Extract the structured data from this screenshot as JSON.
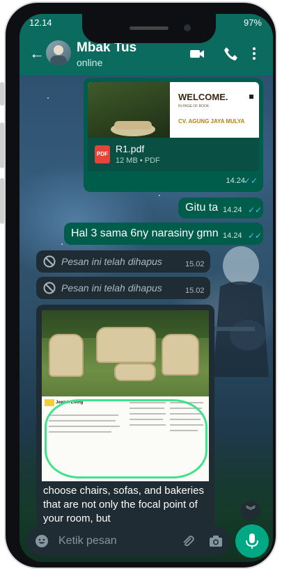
{
  "status": {
    "time": "12.14",
    "battery": "97%"
  },
  "header": {
    "name": "Mbak Tus",
    "presence": "online"
  },
  "messages": {
    "pdf": {
      "welcome": "WELCOME.",
      "sub": "IN PAGE OF BOOK",
      "company": "CV. AGUNG JAYA MULYA",
      "filename": "R1.pdf",
      "fileinfo": "12 MB • PDF",
      "time": "14.24",
      "ticks": "✓✓"
    },
    "gitu": {
      "text": "Gitu ta",
      "time": "14.24",
      "ticks": "✓✓"
    },
    "hal": {
      "text": "Hal 3 sama 6ny narasiny gmn",
      "time": "14.24",
      "ticks": "✓✓"
    },
    "deleted": [
      {
        "text": "Pesan ini telah dihapus",
        "time": "15.02"
      },
      {
        "text": "Pesan ini telah dihapus",
        "time": "15.02"
      }
    ],
    "image": {
      "doc_title": "Jewish Living",
      "caption": "choose chairs, sofas, and bakeries that are not only the focal point of your room, but"
    }
  },
  "input": {
    "placeholder": "Ketik pesan"
  },
  "icons": {
    "back": "arrow-left-icon",
    "video": "video-camera-icon",
    "call": "phone-icon",
    "menu": "more-vertical-icon",
    "emoji": "emoji-icon",
    "attach": "paperclip-icon",
    "camera": "camera-icon",
    "mic": "microphone-icon",
    "scroll": "double-chevron-down-icon"
  },
  "colors": {
    "header": "#0b6b5e",
    "outgoing": "#005c4b",
    "incoming": "#202c33",
    "accent": "#00a884",
    "tick": "#53bdeb"
  }
}
